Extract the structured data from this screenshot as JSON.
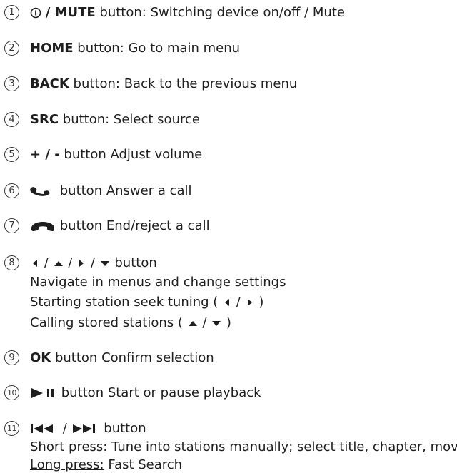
{
  "items": [
    {
      "num": "1",
      "prefix": "/ MUTE",
      "text": " button: Switching device on/off / Mute"
    },
    {
      "num": "2",
      "prefix": "HOME",
      "text": " button: Go to main menu"
    },
    {
      "num": "3",
      "prefix": "BACK",
      "text": " button: Back to the previous menu"
    },
    {
      "num": "4",
      "prefix": "SRC",
      "text": " button: Select source"
    },
    {
      "num": "5",
      "prefix": "+ / -",
      "text": " button Adjust volume"
    },
    {
      "num": "6",
      "text": " button Answer a call"
    },
    {
      "num": "7",
      "text": " button End/reject a call"
    },
    {
      "num": "8",
      "text": " button",
      "sub1": "Navigate in menus and change settings",
      "sub2_a": "Starting station seek tuning (",
      "sub2_b": ")",
      "sub3_a": "Calling stored stations (",
      "sub3_b": ")"
    },
    {
      "num": "9",
      "prefix": "OK",
      "text": " button Confirm selection"
    },
    {
      "num": "10",
      "text": " button Start or pause playback"
    },
    {
      "num": "11",
      "text": " button",
      "short_label": "Short press:",
      "short_text": " Tune into stations manually; select title, chapter, movie",
      "long_label": "Long press:",
      "long_text": " Fast Search"
    }
  ],
  "icons": {
    "power": "power-icon",
    "answer": "phone-answer-icon",
    "end": "phone-end-icon",
    "left": "arrow-left-icon",
    "up": "arrow-up-icon",
    "right": "arrow-right-icon",
    "down": "arrow-down-icon",
    "play_pause": "play-pause-icon",
    "prev": "skip-previous-icon",
    "next": "skip-next-icon"
  },
  "colors": {
    "text": "#1e1e1e"
  }
}
